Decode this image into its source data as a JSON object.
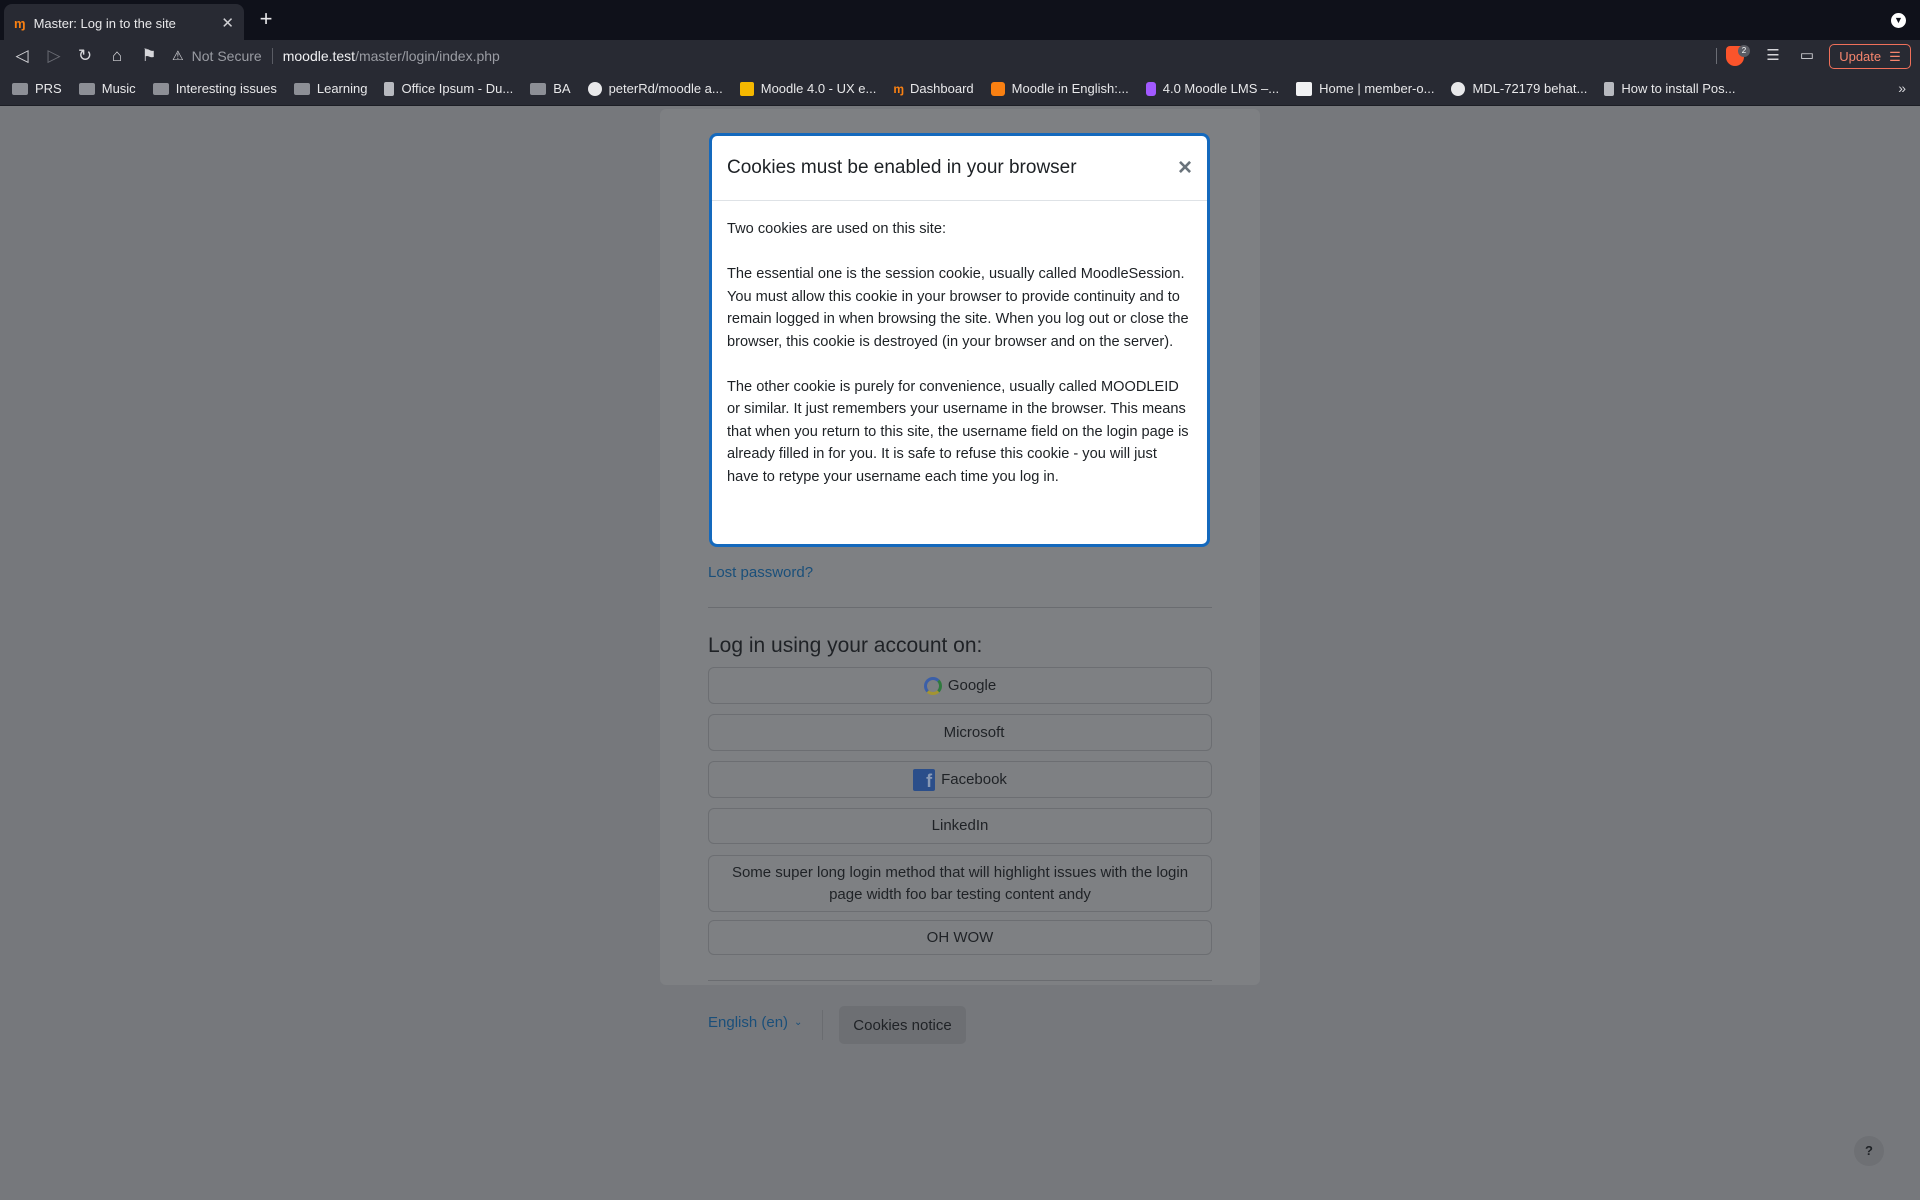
{
  "browser": {
    "tab": {
      "title": "Master: Log in to the site",
      "favicon": "moodle-favicon"
    },
    "address": {
      "security_label": "Not Secure",
      "host": "moodle.test",
      "path": "/master/login/index.php"
    },
    "shields_count": "2",
    "update_label": "Update",
    "bookmarks": [
      {
        "label": "PRS",
        "icon": "folder-icon"
      },
      {
        "label": "Music",
        "icon": "folder-icon"
      },
      {
        "label": "Interesting issues",
        "icon": "folder-icon"
      },
      {
        "label": "Learning",
        "icon": "folder-icon"
      },
      {
        "label": "Office Ipsum - Du...",
        "icon": "plain-icon"
      },
      {
        "label": "BA",
        "icon": "folder-icon"
      },
      {
        "label": "peterRd/moodle a...",
        "icon": "github-icon"
      },
      {
        "label": "Moodle 4.0 - UX e...",
        "icon": "slides-icon"
      },
      {
        "label": "Dashboard",
        "icon": "moodle-icon"
      },
      {
        "label": "Moodle in English:...",
        "icon": "moodle-box-icon"
      },
      {
        "label": "4.0 Moodle LMS –...",
        "icon": "figma-icon"
      },
      {
        "label": "Home | member-o...",
        "icon": "wix-icon"
      },
      {
        "label": "MDL-72179 behat...",
        "icon": "github-icon"
      },
      {
        "label": "How to install Pos...",
        "icon": "plain-icon"
      }
    ]
  },
  "login": {
    "lost_password": "Lost password?",
    "social_heading": "Log in using your account on:",
    "providers": [
      {
        "label": "Google",
        "icon": "google-icon"
      },
      {
        "label": "Microsoft",
        "icon": "microsoft-icon"
      },
      {
        "label": "Facebook",
        "icon": "facebook-icon"
      },
      {
        "label": "LinkedIn",
        "icon": ""
      },
      {
        "label": "Some super long login method that will highlight issues with the login page width foo bar testing content andy",
        "icon": ""
      },
      {
        "label": "OH WOW",
        "icon": ""
      }
    ],
    "language": "English (en)",
    "cookies_notice": "Cookies notice",
    "help": "?"
  },
  "modal": {
    "title": "Cookies must be enabled in your browser",
    "close": "×",
    "paragraphs": [
      "Two cookies are used on this site:",
      "The essential one is the session cookie, usually called MoodleSession. You must allow this cookie in your browser to provide continuity and to remain logged in when browsing the site. When you log out or close the browser, this cookie is destroyed (in your browser and on the server).",
      "The other cookie is purely for convenience, usually called MOODLEID or similar. It just remembers your username in the browser. This means that when you return to this site, the username field on the login page is already filled in for you. It is safe to refuse this cookie - you will just have to retype your username each time you log in."
    ]
  },
  "colors": {
    "modal_border": "#1469bd",
    "link": "#1a4f7a",
    "update_accent": "#f7866e",
    "overlay": "#76787c"
  }
}
